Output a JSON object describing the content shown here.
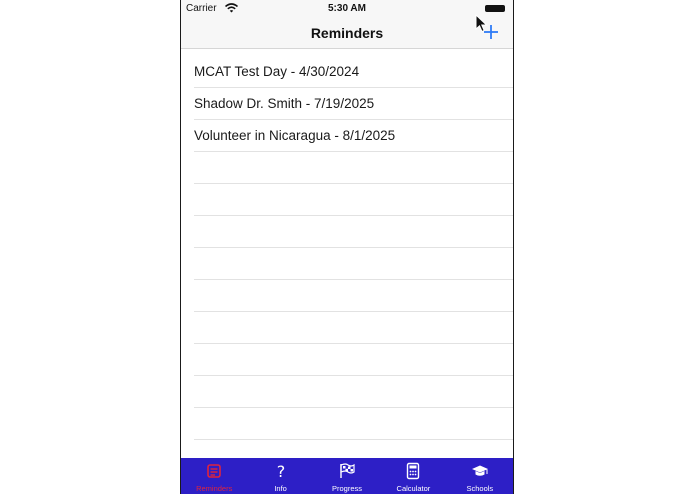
{
  "status_bar": {
    "carrier": "Carrier",
    "time": "5:30 AM"
  },
  "nav": {
    "title": "Reminders",
    "add_icon": "plus-icon"
  },
  "reminders": [
    {
      "label": "MCAT Test Day - 4/30/2024"
    },
    {
      "label": "Shadow Dr. Smith - 7/19/2025"
    },
    {
      "label": "Volunteer in Nicaragua - 8/1/2025"
    },
    {
      "label": ""
    },
    {
      "label": ""
    },
    {
      "label": ""
    },
    {
      "label": ""
    },
    {
      "label": ""
    },
    {
      "label": ""
    },
    {
      "label": ""
    },
    {
      "label": ""
    },
    {
      "label": ""
    }
  ],
  "tab_bar": {
    "tabs": [
      {
        "label": "Reminders",
        "icon": "reminders-icon",
        "active": true
      },
      {
        "label": "Info",
        "icon": "question-icon",
        "active": false
      },
      {
        "label": "Progress",
        "icon": "checkered-flag-icon",
        "active": false
      },
      {
        "label": "Calculator",
        "icon": "calculator-icon",
        "active": false
      },
      {
        "label": "Schools",
        "icon": "graduation-cap-icon",
        "active": false
      }
    ]
  },
  "colors": {
    "tab_bar_background": "#2d1fc6",
    "active_tab": "#e0243c",
    "add_button": "#2f7cf6"
  }
}
